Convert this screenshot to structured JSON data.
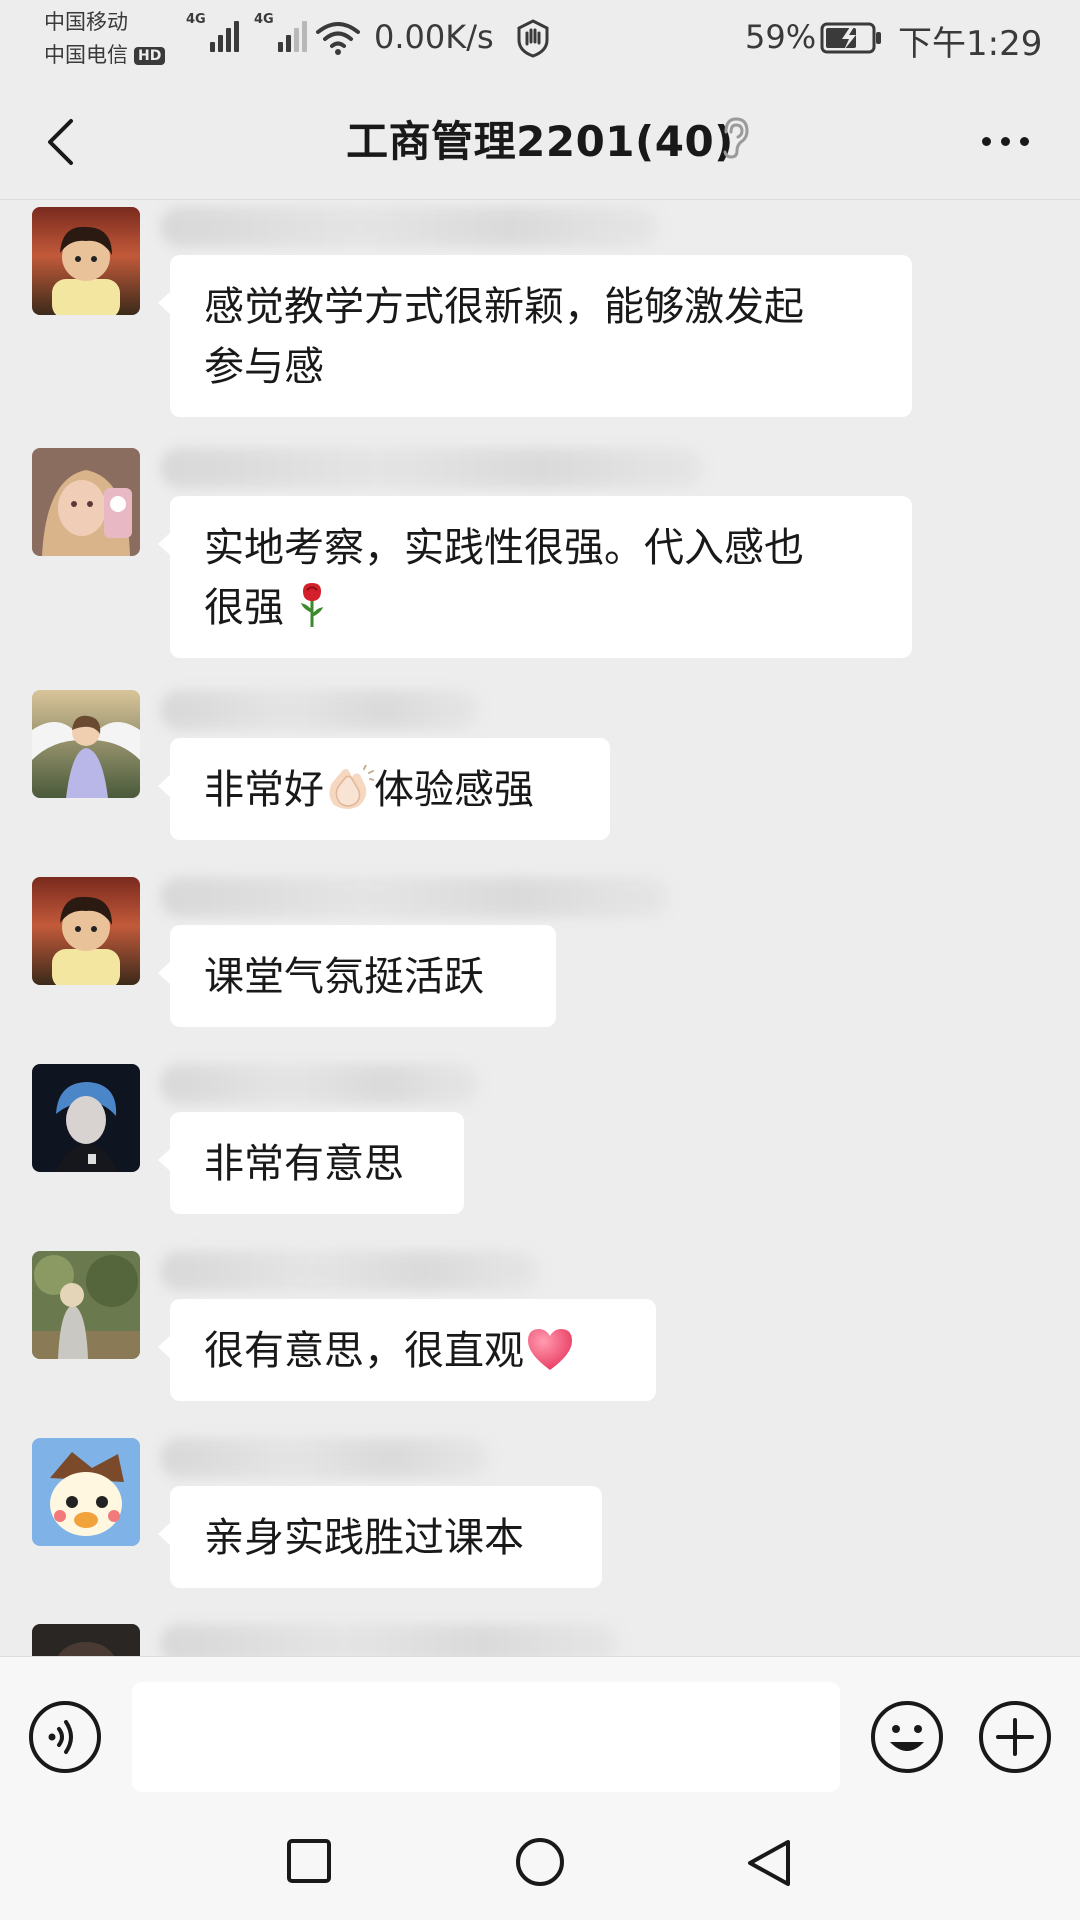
{
  "status_bar": {
    "carrier_1": "中国移动",
    "carrier_2": "中国电信",
    "hd_badge": "HD",
    "network_1": "4G",
    "network_2": "4G",
    "net_speed": "0.00K/s",
    "battery": "59%",
    "time": "下午1:29"
  },
  "nav": {
    "title": "工商管理2201(40)"
  },
  "messages": [
    {
      "text_line1": "感觉教学方式很新颖，能够激发起",
      "text_line2": "参与感"
    },
    {
      "text_line1": "实地考察，实践性很强。代入感也",
      "text_line2": "很强"
    },
    {
      "text_before": "非常好",
      "text_after": "体验感强"
    },
    {
      "text": "课堂气氛挺活跃"
    },
    {
      "text": "非常有意思"
    },
    {
      "text": "很有意思，很直观"
    },
    {
      "text": "亲身实践胜过课本"
    }
  ],
  "icons": {
    "back": "chevron-left-icon",
    "mute": "ear-icon",
    "more": "more-dots-icon",
    "voice": "voice-icon",
    "emoji": "smiley-icon",
    "plus": "plus-icon",
    "rose": "rose-emoji",
    "clap": "clapping-hands-emoji",
    "heart": "heart-emoji"
  },
  "colors": {
    "background": "#ededed",
    "bubble": "#ffffff",
    "text": "#191919"
  }
}
